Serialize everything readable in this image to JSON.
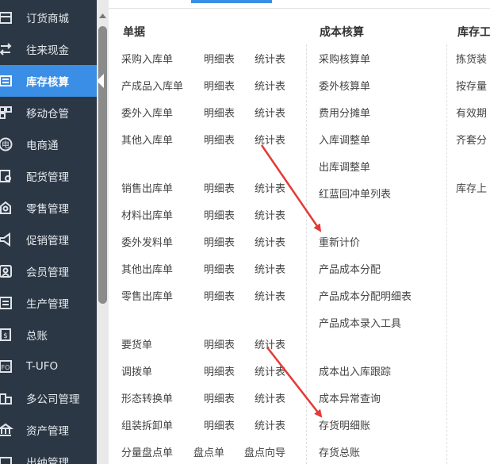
{
  "sidebar": {
    "items": [
      {
        "label": "订货商城",
        "icon": "shop-icon"
      },
      {
        "label": "往来现金",
        "icon": "cash-icon"
      },
      {
        "label": "库存核算",
        "icon": "inventory-icon",
        "active": true
      },
      {
        "label": "移动仓管",
        "icon": "mobile-warehouse-icon"
      },
      {
        "label": "电商通",
        "icon": "ecommerce-icon"
      },
      {
        "label": "配货管理",
        "icon": "distribution-icon"
      },
      {
        "label": "零售管理",
        "icon": "retail-icon"
      },
      {
        "label": "促销管理",
        "icon": "megaphone-icon"
      },
      {
        "label": "会员管理",
        "icon": "member-icon"
      },
      {
        "label": "生产管理",
        "icon": "production-icon"
      },
      {
        "label": "总账",
        "icon": "ledger-icon"
      },
      {
        "label": "T-UFO",
        "icon": "report-icon"
      },
      {
        "label": "多公司管理",
        "icon": "multi-company-icon"
      },
      {
        "label": "资产管理",
        "icon": "asset-icon"
      },
      {
        "label": "出纳管理",
        "icon": "cashier-icon"
      }
    ]
  },
  "columns": {
    "documents": {
      "title": "单据",
      "groups": [
        [
          {
            "name": "采购入库单",
            "detail": "明细表",
            "stats": "统计表"
          },
          {
            "name": "产成品入库单",
            "detail": "明细表",
            "stats": "统计表"
          },
          {
            "name": "委外入库单",
            "detail": "明细表",
            "stats": "统计表"
          },
          {
            "name": "其他入库单",
            "detail": "明细表",
            "stats": "统计表"
          }
        ],
        [
          {
            "name": "销售出库单",
            "detail": "明细表",
            "stats": "统计表"
          },
          {
            "name": "材料出库单",
            "detail": "明细表",
            "stats": "统计表"
          },
          {
            "name": "委外发料单",
            "detail": "明细表",
            "stats": "统计表"
          },
          {
            "name": "其他出库单",
            "detail": "明细表",
            "stats": "统计表"
          },
          {
            "name": "零售出库单",
            "detail": "明细表",
            "stats": "统计表"
          }
        ],
        [
          {
            "name": "要货单",
            "detail": "明细表",
            "stats": "统计表"
          },
          {
            "name": "调拨单",
            "detail": "明细表",
            "stats": "统计表"
          },
          {
            "name": "形态转换单",
            "detail": "明细表",
            "stats": "统计表"
          },
          {
            "name": "组装拆卸单",
            "detail": "明细表",
            "stats": "统计表"
          },
          {
            "name": "分量盘点单",
            "detail": "盘点单",
            "stats": "盘点向导"
          }
        ]
      ]
    },
    "costing": {
      "title": "成本核算",
      "groups": [
        [
          "采购核算单",
          "委外核算单",
          "费用分摊单",
          "入库调整单",
          "出库调整单",
          "红蓝回冲单列表"
        ],
        [
          "重新计价",
          "产品成本分配",
          "产品成本分配明细表",
          "产品成本录入工具"
        ],
        [
          "成本出入库跟踪",
          "成本异常查询",
          "存货明细账",
          "存货总账"
        ]
      ]
    },
    "tools": {
      "title": "库存工",
      "groups": [
        [
          "拣货装",
          "按存量",
          "有效期",
          "齐套分"
        ],
        [
          "库存上"
        ]
      ]
    }
  },
  "colors": {
    "sidebar_bg": "#2b3745",
    "active_bg": "#3a8ee6",
    "arrow": "#e53935"
  }
}
